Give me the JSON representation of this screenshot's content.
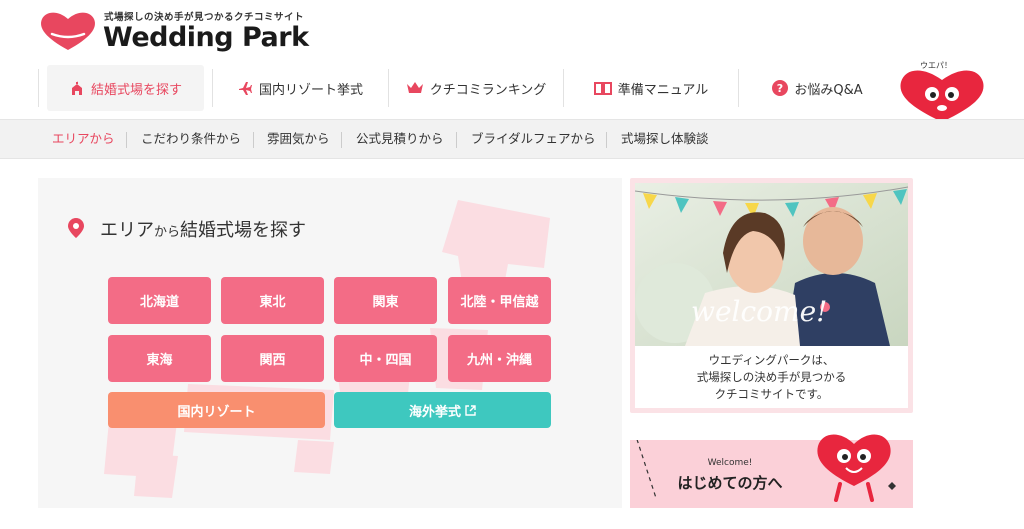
{
  "brand": {
    "tagline": "式場探しの決め手が見つかるクチコミサイト",
    "name": "Wedding Park",
    "color": "#e8475f"
  },
  "mainnav": {
    "items": [
      {
        "label": "結婚式場を探す",
        "icon": "church-icon",
        "active": true
      },
      {
        "label": "国内リゾート挙式",
        "icon": "airplane-icon",
        "active": false
      },
      {
        "label": "クチコミランキング",
        "icon": "crown-icon",
        "active": false
      },
      {
        "label": "準備マニュアル",
        "icon": "book-icon",
        "active": false
      },
      {
        "label": "お悩みQ&A",
        "icon": "question-icon",
        "active": false
      }
    ],
    "mascot_label": "ウエパ！"
  },
  "subnav": {
    "items": [
      {
        "label": "エリアから",
        "active": true
      },
      {
        "label": "こだわり条件から",
        "active": false
      },
      {
        "label": "雰囲気から",
        "active": false
      },
      {
        "label": "公式見積りから",
        "active": false
      },
      {
        "label": "ブライダルフェアから",
        "active": false
      },
      {
        "label": "式場探し体験談",
        "active": false
      }
    ]
  },
  "area": {
    "title_part1": "エリア",
    "title_part2": "から",
    "title_part3": "結婚式場を探す",
    "regions": [
      "北海道",
      "東北",
      "関東",
      "北陸・甲信越",
      "東海",
      "関西",
      "中・四国",
      "九州・沖縄"
    ],
    "resort_label": "国内リゾート",
    "abroad_label": "海外挙式",
    "button_color": "#f36c86",
    "resort_color": "#f98f6f",
    "abroad_color": "#3ec8bf"
  },
  "welcome": {
    "script_text": "welcome!",
    "line1": "ウエディングパークは、",
    "line2": "式場探しの決め手が見つかる",
    "line3": "クチコミサイトです。"
  },
  "first_time": {
    "small": "Welcome!",
    "big": "はじめての方へ"
  }
}
